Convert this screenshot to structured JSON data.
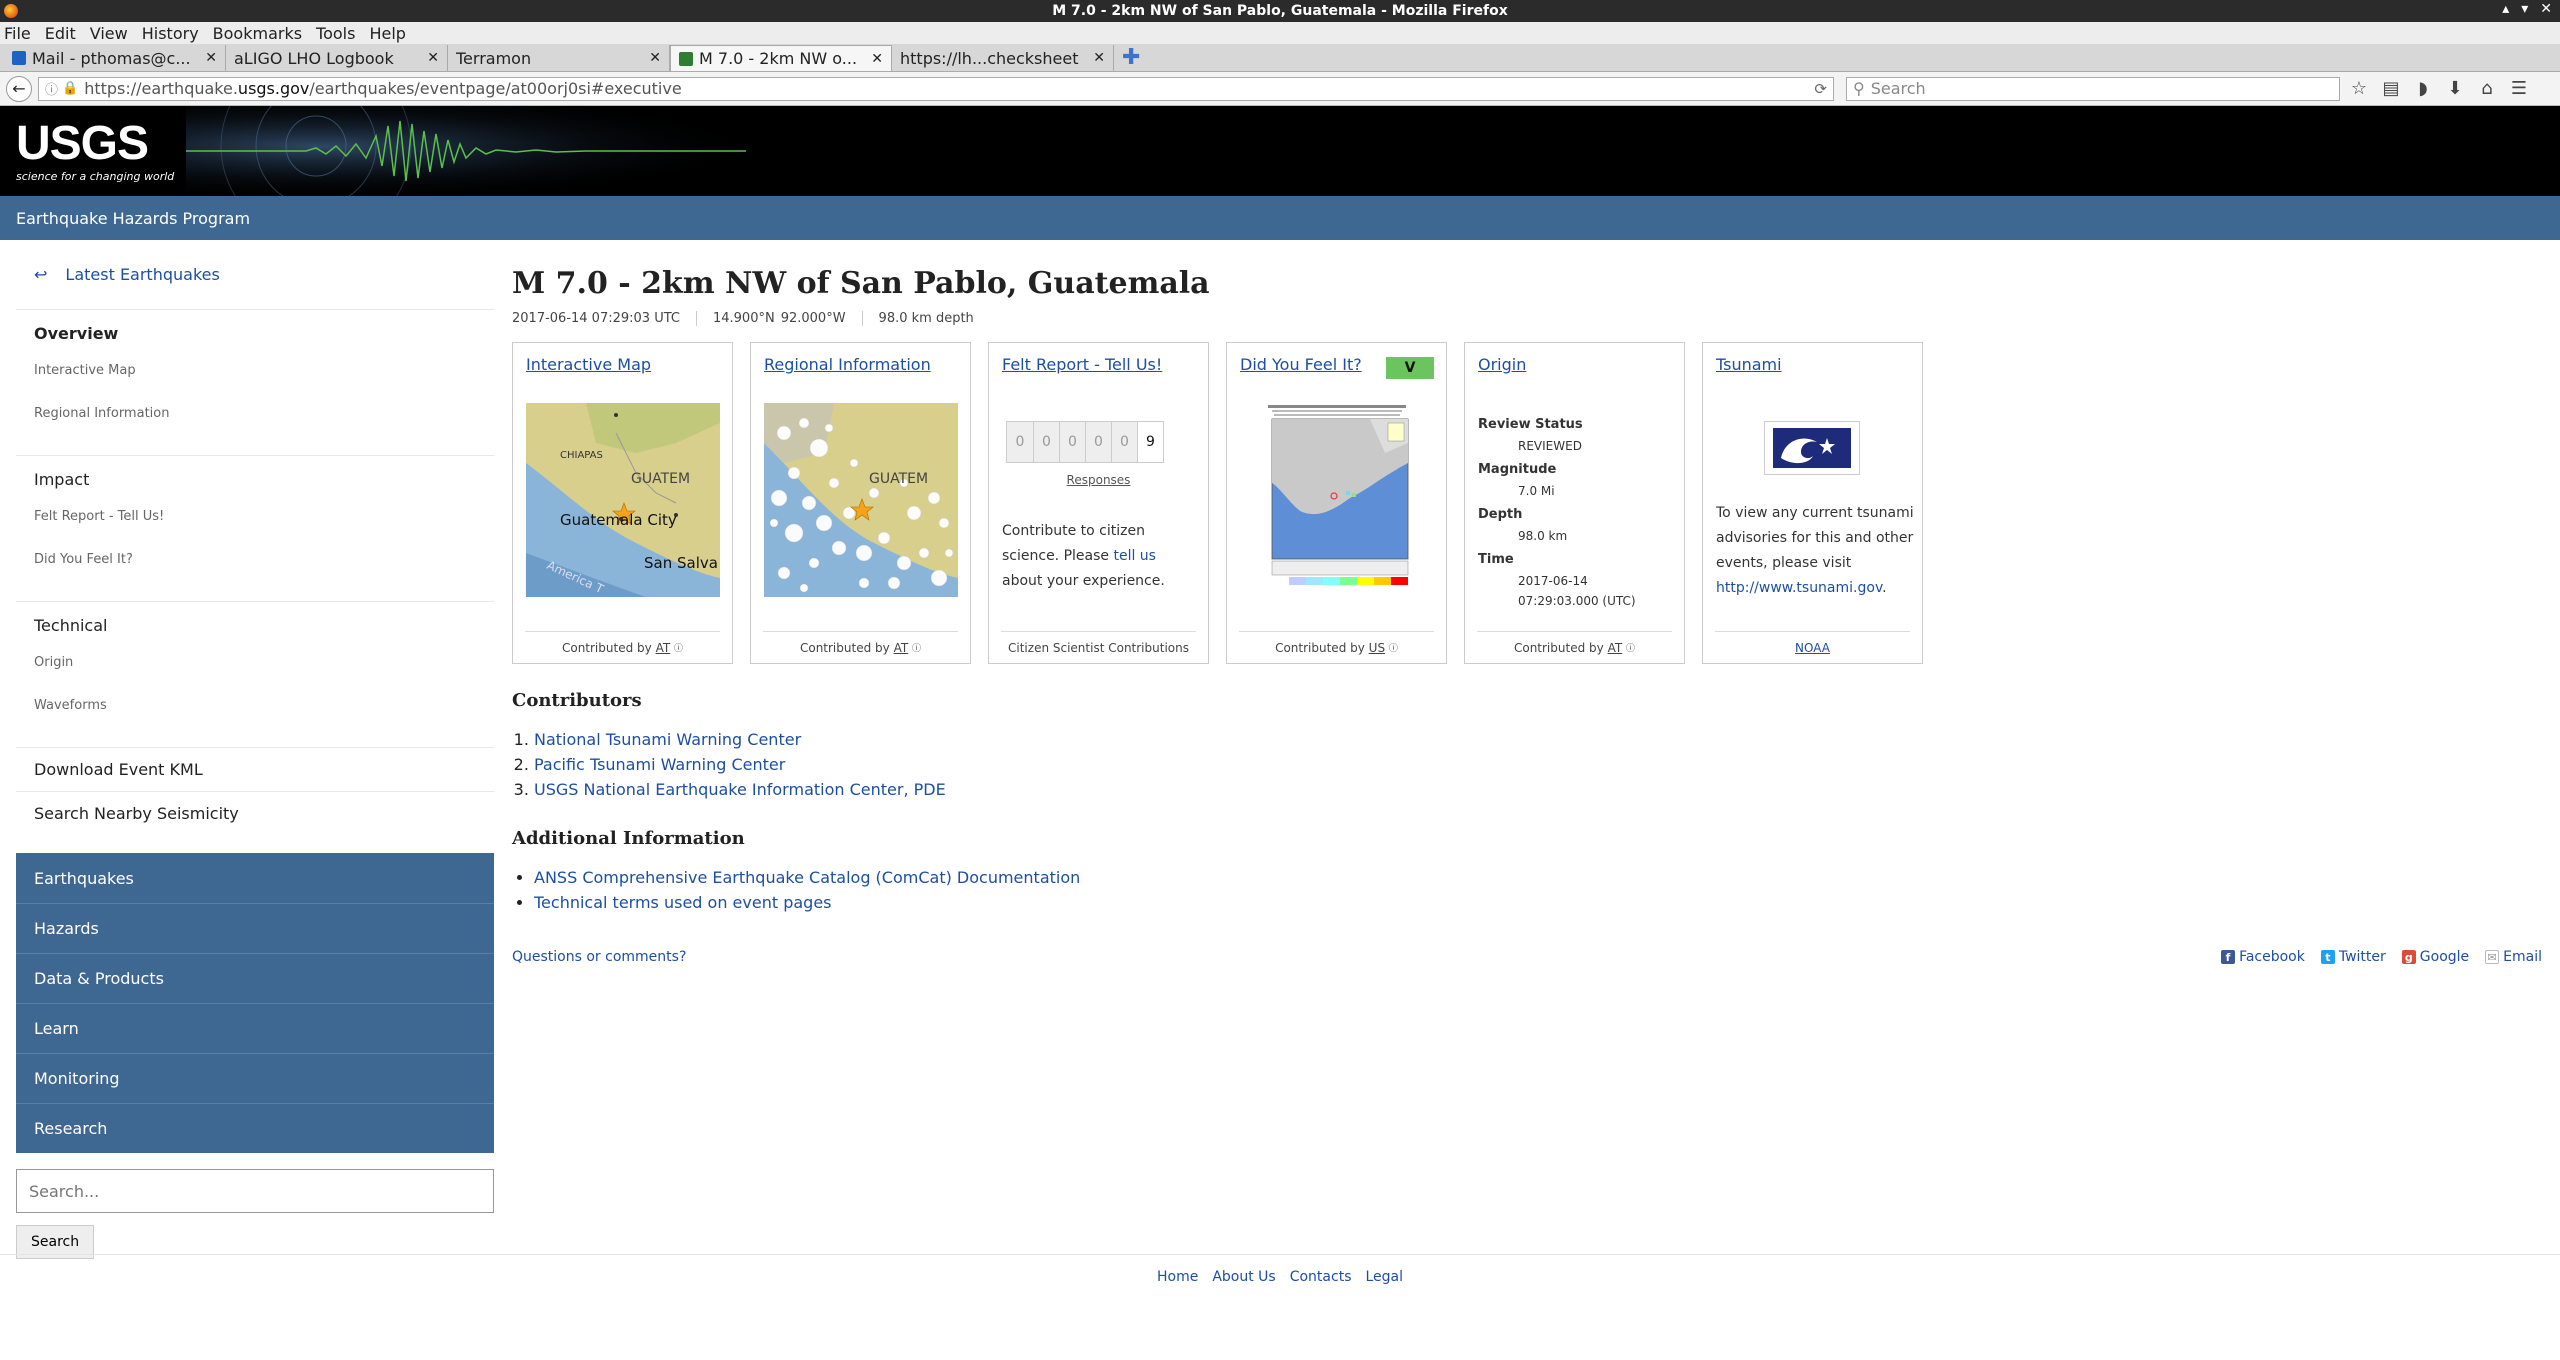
{
  "window": {
    "title": "M 7.0 - 2km NW of San Pablo, Guatemala - Mozilla Firefox"
  },
  "menu": [
    "File",
    "Edit",
    "View",
    "History",
    "Bookmarks",
    "Tools",
    "Help"
  ],
  "tabs": [
    {
      "label": "Mail - pthomas@c...",
      "icon_color": "#1e62c6"
    },
    {
      "label": "aLIGO LHO Logbook",
      "icon_color": ""
    },
    {
      "label": "Terramon",
      "icon_color": ""
    },
    {
      "label": "M 7.0 - 2km NW o...",
      "icon_color": "#2e7d32"
    },
    {
      "label": "https://lh...checksheet",
      "icon_color": ""
    }
  ],
  "url": {
    "prefix": "https://earthquake.",
    "host": "usgs.gov",
    "path": "/earthquakes/eventpage/at00orj0si#executive"
  },
  "search_placeholder": "Search",
  "header": {
    "logo": "USGS",
    "tagline": "science for a changing world",
    "program": "Earthquake Hazards Program"
  },
  "sidebar": {
    "back": "Latest Earthquakes",
    "overview": {
      "title": "Overview",
      "items": [
        "Interactive Map",
        "Regional Information"
      ]
    },
    "impact": {
      "title": "Impact",
      "items": [
        "Felt Report - Tell Us!",
        "Did You Feel It?"
      ]
    },
    "technical": {
      "title": "Technical",
      "items": [
        "Origin",
        "Waveforms"
      ]
    },
    "links": [
      "Download Event KML",
      "Search Nearby Seismicity"
    ],
    "nav": [
      "Earthquakes",
      "Hazards",
      "Data & Products",
      "Learn",
      "Monitoring",
      "Research"
    ],
    "search_placeholder": "Search...",
    "search_button": "Search"
  },
  "event": {
    "title": "M 7.0 - 2km NW of San Pablo, Guatemala",
    "time": "2017-06-14 07:29:03 UTC",
    "lat": "14.900°N",
    "lon": "92.000°W",
    "depth": "98.0 km depth"
  },
  "cards": {
    "map": {
      "title": "Interactive Map",
      "foot": "Contributed by",
      "src": "AT",
      "labels": [
        "CHIAPAS",
        "GUATEM",
        "Guatemala City",
        "San Salva",
        "America T"
      ]
    },
    "regional": {
      "title": "Regional Information",
      "foot": "Contributed by",
      "src": "AT",
      "labels": [
        "GUATEM"
      ]
    },
    "felt": {
      "title": "Felt Report - Tell Us!",
      "digits": [
        "0",
        "0",
        "0",
        "0",
        "0",
        "9"
      ],
      "responses": "Responses",
      "text_before": "Contribute to citizen science. Please ",
      "text_link": "tell us",
      "text_after": " about your experience.",
      "foot": "Citizen Scientist Contributions"
    },
    "dyfi": {
      "title": "Did You Feel It?",
      "badge": "V",
      "foot": "Contributed by",
      "src": "US"
    },
    "origin": {
      "title": "Origin",
      "status_label": "Review Status",
      "status": "REVIEWED",
      "mag_label": "Magnitude",
      "mag": "7.0 Mi",
      "depth_label": "Depth",
      "depth": "98.0 km",
      "time_label": "Time",
      "time_date": "2017-06-14",
      "time_clock": "07:29:03.000 (UTC)",
      "foot": "Contributed by",
      "src": "AT"
    },
    "tsunami": {
      "title": "Tsunami",
      "text": "To view any current tsunami advisories for this and other events, please visit ",
      "link": "http://www.tsunami.gov",
      "text_after": ".",
      "foot": "NOAA"
    }
  },
  "contributors": {
    "heading": "Contributors",
    "items": [
      "National Tsunami Warning Center",
      "Pacific Tsunami Warning Center",
      "USGS National Earthquake Information Center, PDE"
    ]
  },
  "additional": {
    "heading": "Additional Information",
    "items": [
      "ANSS Comprehensive Earthquake Catalog (ComCat) Documentation",
      "Technical terms used on event pages"
    ]
  },
  "questions": "Questions or comments?",
  "share": [
    "Facebook",
    "Twitter",
    "Google",
    "Email"
  ],
  "footer": [
    "Home",
    "About Us",
    "Contacts",
    "Legal"
  ],
  "colors": {
    "header_blue": "#3e6792",
    "link": "#1c4fa3",
    "mmi_v": "#6bc460"
  }
}
